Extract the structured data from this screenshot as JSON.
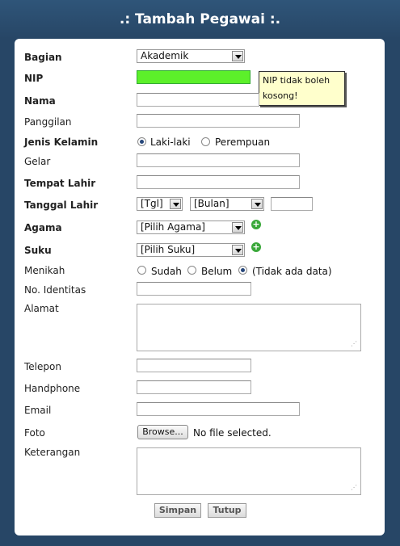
{
  "title": ".: Tambah Pegawai :.",
  "labels": {
    "bagian": "Bagian",
    "nip": "NIP",
    "nama": "Nama",
    "panggilan": "Panggilan",
    "jenis_kelamin": "Jenis Kelamin",
    "gelar": "Gelar",
    "tempat_lahir": "Tempat Lahir",
    "tanggal_lahir": "Tanggal Lahir",
    "agama": "Agama",
    "suku": "Suku",
    "menikah": "Menikah",
    "no_identitas": "No. Identitas",
    "alamat": "Alamat",
    "telepon": "Telepon",
    "handphone": "Handphone",
    "email": "Email",
    "foto": "Foto",
    "keterangan": "Keterangan"
  },
  "bagian_selected": "Akademik",
  "tooltip": "NIP tidak boleh kosong!",
  "gender": {
    "male": "Laki-laki",
    "female": "Perempuan",
    "selected": "Laki-laki"
  },
  "tanggal": {
    "day": "[Tgl]",
    "month": "[Bulan]"
  },
  "agama_selected": "[Pilih Agama]",
  "suku_selected": "[Pilih Suku]",
  "menikah": {
    "opt1": "Sudah",
    "opt2": "Belum",
    "opt3": "(Tidak ada data)",
    "selected": "(Tidak ada data)"
  },
  "foto": {
    "button": "Browse...",
    "status": "No file selected."
  },
  "buttons": {
    "save": "Simpan",
    "close": "Tutup"
  },
  "colors": {
    "frame": "#274666",
    "nip_invalid": "#5cf02a",
    "tooltip": "#ffffcc"
  }
}
